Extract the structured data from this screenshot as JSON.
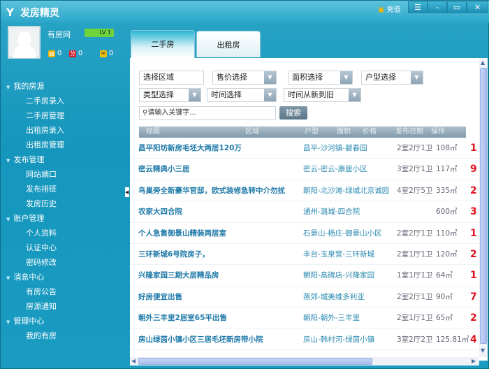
{
  "app": {
    "title": "发房精灵",
    "recharge": "充值",
    "window_buttons": [
      "menu-icon",
      "minimize-icon",
      "maximize-icon",
      "close-icon"
    ]
  },
  "user": {
    "name": "有房网",
    "level": "LV 1",
    "coins": "0",
    "points": "0",
    "messages": "0"
  },
  "sidebar": [
    {
      "label": "我的房源",
      "items": [
        "二手房录入",
        "二手房管理",
        "出租房录入",
        "出租房管理"
      ]
    },
    {
      "label": "发布管理",
      "items": [
        "网站端口",
        "发布排班",
        "发房历史"
      ]
    },
    {
      "label": "账户管理",
      "items": [
        "个人资料",
        "认证中心",
        "密码修改"
      ]
    },
    {
      "label": "消息中心",
      "items": [
        "有房公告",
        "房源通知"
      ]
    },
    {
      "label": "管理中心",
      "items": [
        "我的有房"
      ]
    }
  ],
  "tabs": [
    "二手房",
    "出租房"
  ],
  "filters": {
    "region": "选择区域",
    "price": "售价选择",
    "area": "面积选择",
    "layout": "户型选择",
    "type": "类型选择",
    "time": "时间选择",
    "sort": "时间从新到旧",
    "search_placeholder": "请输入关键字...",
    "search_button": "搜索"
  },
  "table": {
    "headers": [
      "标题",
      "区域",
      "户型",
      "面积",
      "价格",
      "发布日期",
      "操作"
    ],
    "rows": [
      {
        "title": "昌平阳坊新房毛坯大两居120万",
        "region": "昌平-沙河镇-碧春园",
        "layout": "2室2厅1卫",
        "size": "108㎡",
        "price": "1"
      },
      {
        "title": "密云精典小三居",
        "region": "密云-密云-康居小区",
        "layout": "3室2厅1卫",
        "size": "117㎡",
        "price": "9"
      },
      {
        "title": "鸟巢旁全新豪华官邸，欧式装修急转中介勿扰",
        "region": "朝阳-北沙滩-绿城北京诚园",
        "layout": "4室2厅5卫",
        "size": "335㎡",
        "price": "2"
      },
      {
        "title": "农家大四合院",
        "region": "通州-潞城-四合院",
        "layout": "",
        "size": "600㎡",
        "price": "3"
      },
      {
        "title": "个人急售御景山精装两居室",
        "region": "石景山-杨庄-御景山小区",
        "layout": "2室2厅1卫",
        "size": "110㎡",
        "price": "1"
      },
      {
        "title": "三环新城6号院房子，",
        "region": "丰台-玉泉营-三环新城",
        "layout": "2室1厅1卫",
        "size": "120㎡",
        "price": "2"
      },
      {
        "title": "兴隆家园三期大居精品房",
        "region": "朝阳-高碑店-兴隆家园",
        "layout": "1室1厅1卫",
        "size": "64㎡",
        "price": "1"
      },
      {
        "title": "好房便宜出售",
        "region": "燕郊-城美维多利亚",
        "layout": "2室2厅1卫",
        "size": "90㎡",
        "price": "7"
      },
      {
        "title": "朝外三丰里2居室65平出售",
        "region": "朝阳-朝外-三丰里",
        "layout": "2室1厅1卫",
        "size": "65㎡",
        "price": "2"
      },
      {
        "title": "房山绿茵小镇小区三居毛坯新房带小院",
        "region": "房山-韩村河-绿茵小镇",
        "layout": "3室2厅2卫",
        "size": "125.81㎡",
        "price": "4"
      }
    ]
  },
  "colors": {
    "accent": "#1a9cc2",
    "title_link": "#1f7aa8",
    "price": "#e0141e"
  }
}
